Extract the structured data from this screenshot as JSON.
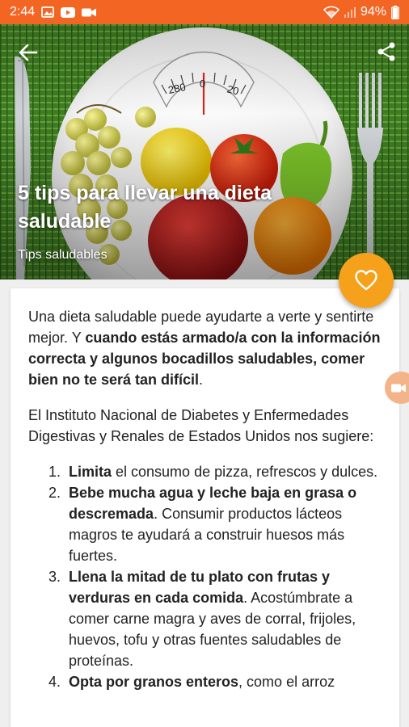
{
  "status_bar": {
    "time": "2:44",
    "battery": "94%",
    "icons": [
      "gallery-icon",
      "youtube-icon",
      "video-icon",
      "wifi-icon",
      "signal-icon",
      "battery-icon"
    ]
  },
  "header": {
    "title": "5 tips para llevar una dieta saludable",
    "category": "Tips saludables",
    "scale_numbers": [
      "280",
      "0",
      "20"
    ]
  },
  "article": {
    "intro": {
      "plain": "Una dieta saludable puede ayudarte a verte y sentirte mejor. Y ",
      "bold": "cuando estás armado/a con la información correcta y algunos bocadillos saludables, comer bien no te será tan difícil",
      "end": "."
    },
    "source": "El Instituto Nacional de Diabetes y Enfermedades Digestivas y Renales de Estados Unidos nos sugiere:",
    "tips": [
      {
        "num": "1.",
        "bold": "Limita",
        "text": " el consumo de pizza, refrescos y dulces."
      },
      {
        "num": "2.",
        "bold": "Bebe mucha agua y leche baja en grasa o descremada",
        "text": ". Consumir productos lácteos magros te ayudará a construir huesos más fuertes."
      },
      {
        "num": "3.",
        "bold": "Llena la mitad de tu plato con frutas y verduras en cada comida",
        "text": ". Acostúmbrate a comer carne magra y aves de corral, frijoles, huevos, tofu y otras fuentes saludables de proteínas."
      },
      {
        "num": "4.",
        "bold": "Opta por granos enteros",
        "text": ", como el arroz"
      }
    ]
  },
  "colors": {
    "status_bar": "#f26522",
    "fab": "#f5a11b",
    "card_bg": "#ffffff",
    "page_bg": "#efefef"
  }
}
